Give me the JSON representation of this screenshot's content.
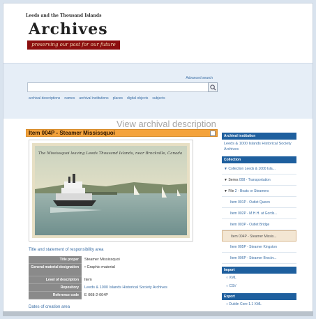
{
  "header": {
    "org": "Leeds and the Thousand Islands",
    "title": "Archives",
    "tagline": "preserving our past for our future"
  },
  "search": {
    "advanced_label": "Advanced search",
    "placeholder": "",
    "nav": [
      "archival descriptions",
      "names",
      "archival institutions",
      "places",
      "digital objects",
      "subjects"
    ]
  },
  "page": {
    "heading": "View archival description",
    "item_title": "Item 004P - Steamer Mississquoi",
    "photo_caption": "The Mississquoi leaving Leeds Thousand Islands, near Brockville, Canada",
    "sections": {
      "title_statement": "Title and statement of responsibility area",
      "dates": "Dates of creation area"
    },
    "fields": [
      {
        "label": "Title proper",
        "value": "Steamer Mississquoi",
        "link": false
      },
      {
        "label": "General material designation",
        "value": "Graphic material",
        "link": false,
        "bullet": true
      },
      {
        "label": "Level of description",
        "value": "Item",
        "link": false
      },
      {
        "label": "Repository",
        "value": "Leeds & 1000 Islands Historical Society Archives",
        "link": true
      },
      {
        "label": "Reference code",
        "value": "E 008-2-004P",
        "link": false
      }
    ]
  },
  "sidebar": {
    "institution_head": "Archival institution",
    "institution_name": "Leeds & 1000 Islands Historical Society Archives",
    "collection_head": "Collection",
    "tree": [
      {
        "prefix": "▼ Collection",
        "label": "Leeds & 1000 Isla...",
        "indent": false,
        "active": false,
        "tree": true
      },
      {
        "prefix": "▼ Series",
        "label": "008 - Transportation",
        "indent": false,
        "active": false,
        "tree": true
      },
      {
        "prefix": "▼ File",
        "label": "2 - Boats or Steamers",
        "indent": false,
        "active": false,
        "tree": true
      },
      {
        "prefix": "Item",
        "label": "001P - Outlet Queen",
        "indent": true,
        "active": false,
        "tree": false
      },
      {
        "prefix": "Item",
        "label": "002P - M.H.H. at Gords...",
        "indent": true,
        "active": false,
        "tree": false
      },
      {
        "prefix": "Item",
        "label": "003P - Outlet Bridge",
        "indent": true,
        "active": false,
        "tree": false
      },
      {
        "prefix": "Item",
        "label": "004P - Steamer Missis...",
        "indent": true,
        "active": true,
        "tree": false
      },
      {
        "prefix": "Item",
        "label": "005P - Steamer Kingston",
        "indent": true,
        "active": false,
        "tree": false
      },
      {
        "prefix": "Item",
        "label": "006P - Steamer Brockv...",
        "indent": true,
        "active": false,
        "tree": false
      }
    ],
    "import_head": "Import",
    "import_items": [
      "XML",
      "CSV"
    ],
    "export_head": "Export",
    "export_items": [
      "Dublin Core 1.1 XML"
    ]
  },
  "colors": {
    "accent_orange": "#f4a33c",
    "sidebar_blue": "#1e5f9e",
    "brand_red": "#8c0f0f",
    "link_blue": "#3a6ea5"
  },
  "icons": [
    "search-icon",
    "print-icon"
  ]
}
